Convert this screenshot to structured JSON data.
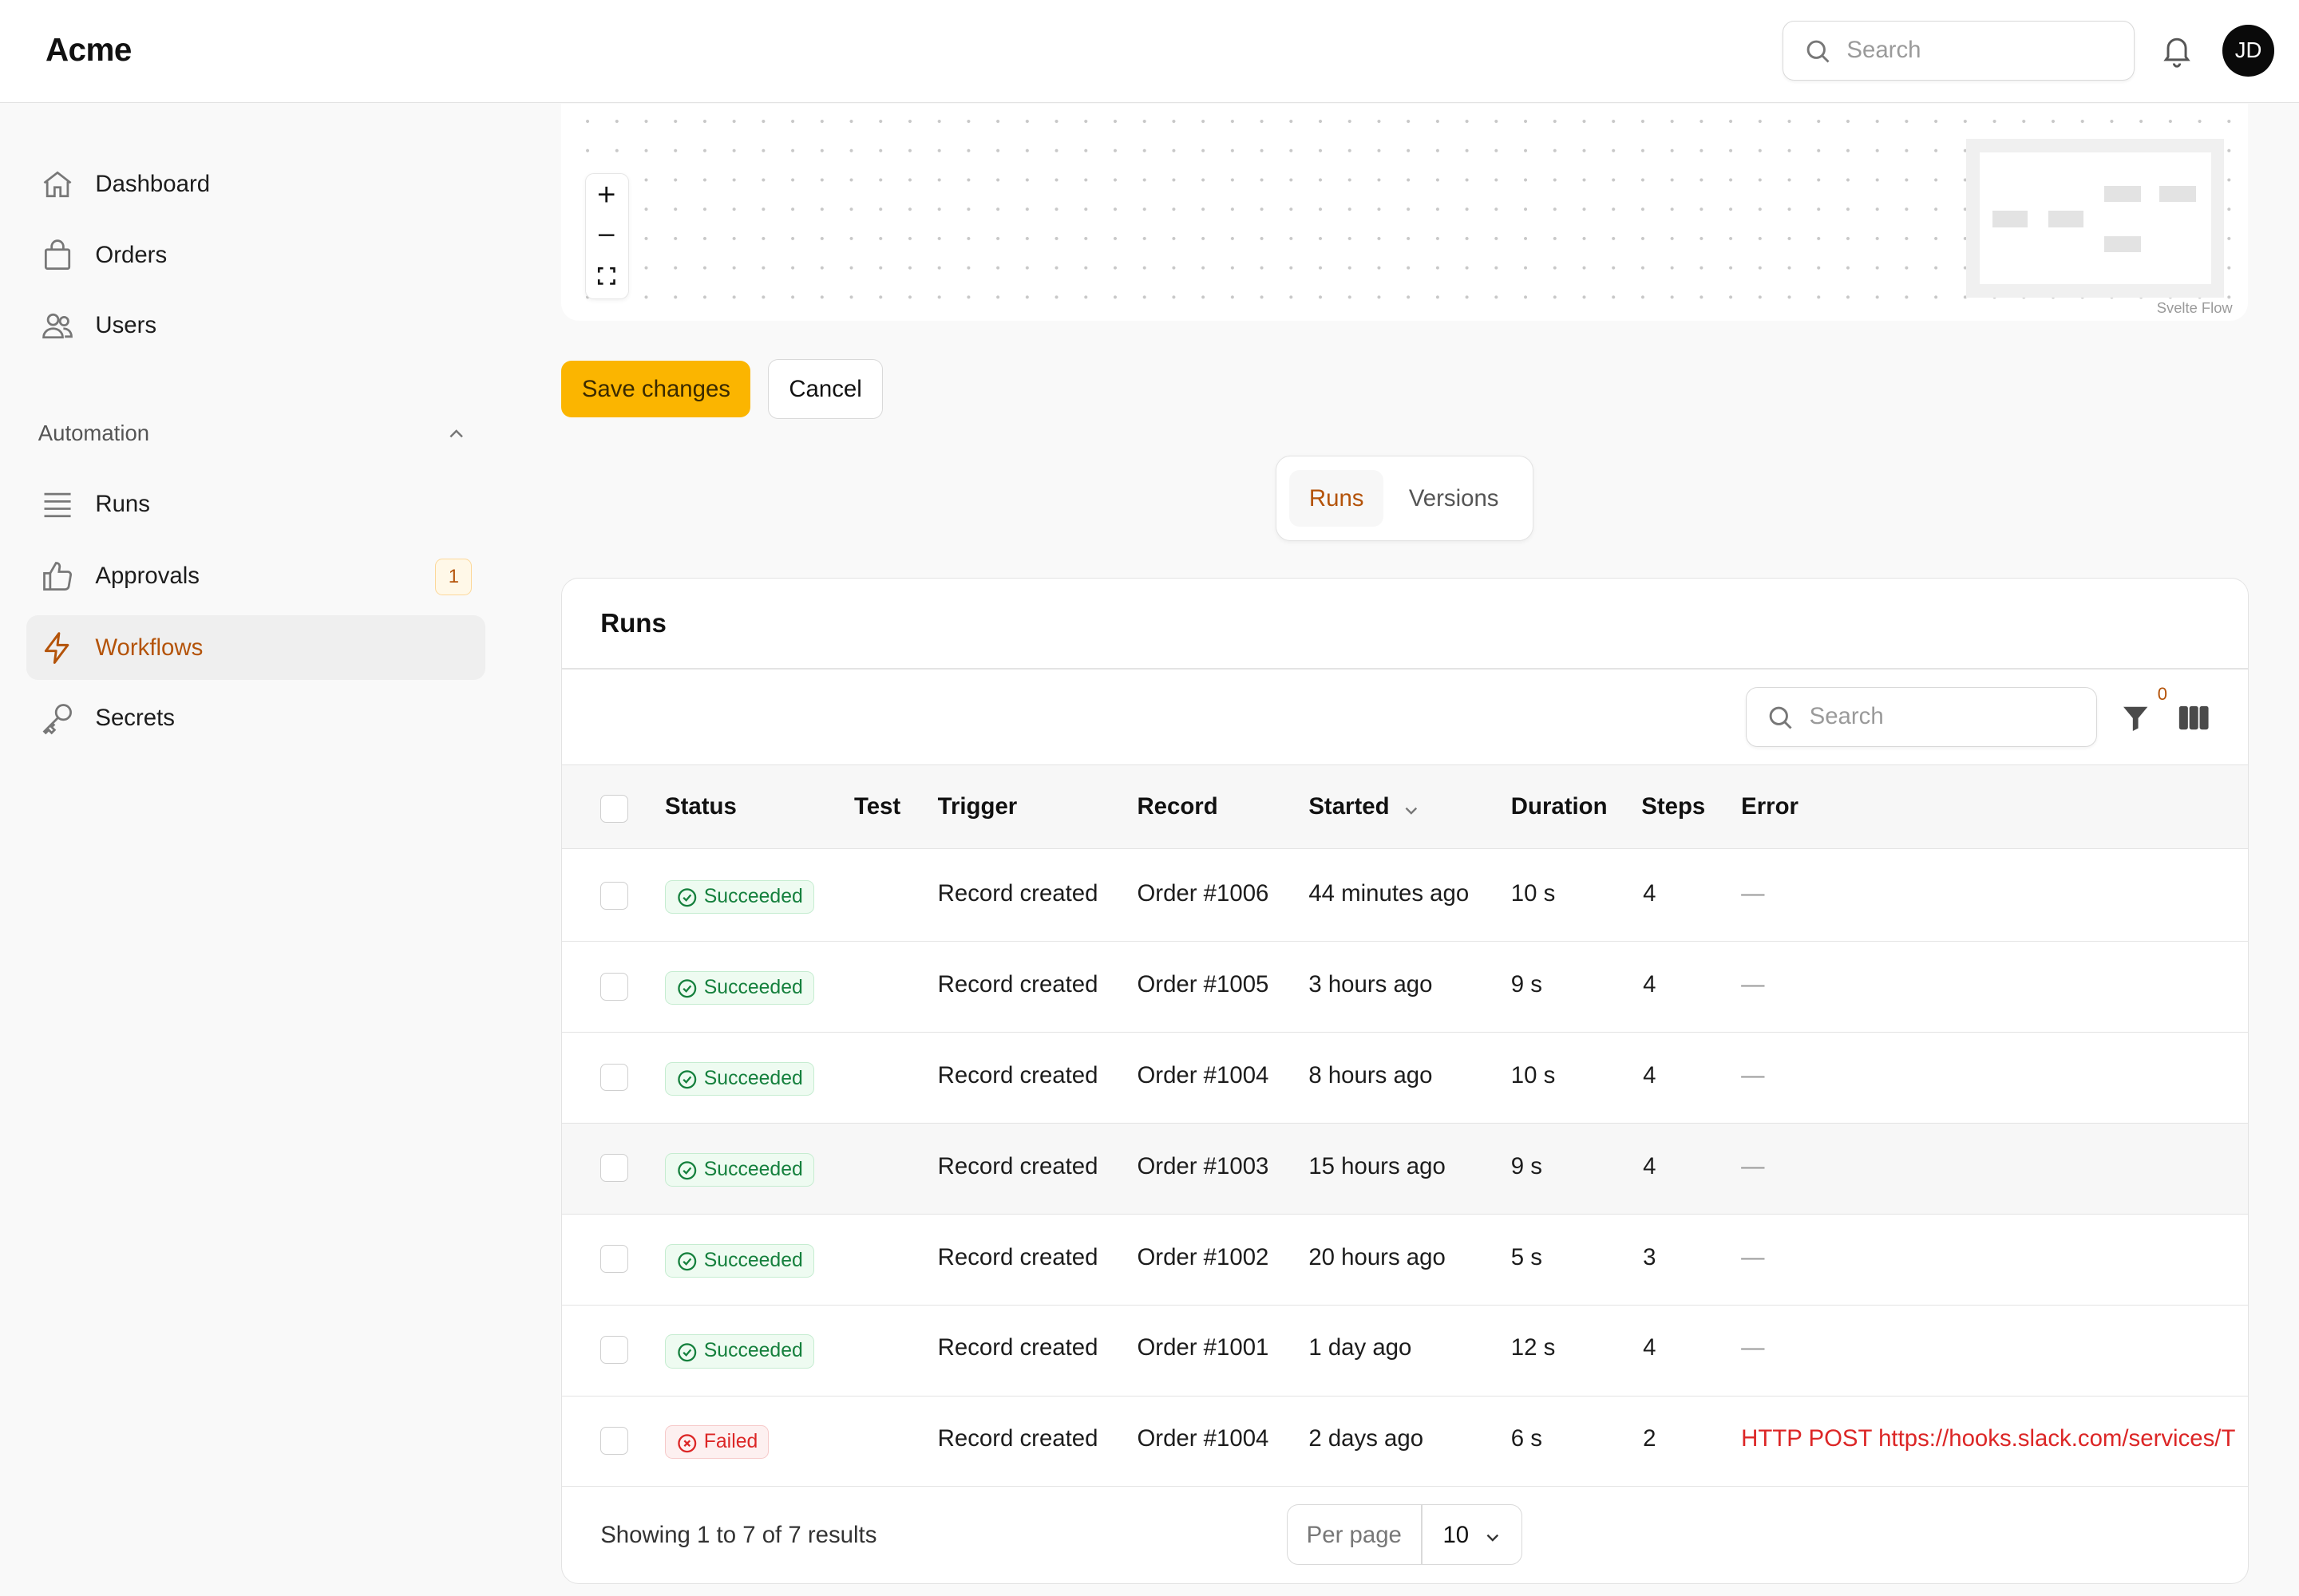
{
  "header": {
    "brand": "Acme",
    "search_placeholder": "Search",
    "avatar_initials": "JD"
  },
  "sidebar": {
    "items": [
      {
        "label": "Dashboard",
        "icon": "home-icon"
      },
      {
        "label": "Orders",
        "icon": "shopping-bag-icon"
      },
      {
        "label": "Users",
        "icon": "users-icon"
      }
    ],
    "section_title": "Automation",
    "section_items": [
      {
        "label": "Runs",
        "icon": "list-icon"
      },
      {
        "label": "Approvals",
        "icon": "thumbs-up-icon",
        "badge": "1"
      },
      {
        "label": "Workflows",
        "icon": "bolt-icon",
        "active": true
      },
      {
        "label": "Secrets",
        "icon": "key-icon"
      }
    ]
  },
  "canvas": {
    "credit": "Svelte Flow"
  },
  "actions": {
    "save_label": "Save changes",
    "cancel_label": "Cancel"
  },
  "tabs": {
    "runs": "Runs",
    "versions": "Versions",
    "active": "Runs"
  },
  "runs_card": {
    "title": "Runs",
    "search_placeholder": "Search",
    "filter_count": "0",
    "columns": {
      "status": "Status",
      "test": "Test",
      "trigger": "Trigger",
      "record": "Record",
      "started": "Started",
      "duration": "Duration",
      "steps": "Steps",
      "error": "Error"
    },
    "rows": [
      {
        "status": "Succeeded",
        "trigger": "Record created",
        "record": "Order #1006",
        "started": "44 minutes ago",
        "duration": "10 s",
        "steps": "4",
        "error": "—"
      },
      {
        "status": "Succeeded",
        "trigger": "Record created",
        "record": "Order #1005",
        "started": "3 hours ago",
        "duration": "9 s",
        "steps": "4",
        "error": "—"
      },
      {
        "status": "Succeeded",
        "trigger": "Record created",
        "record": "Order #1004",
        "started": "8 hours ago",
        "duration": "10 s",
        "steps": "4",
        "error": "—"
      },
      {
        "status": "Succeeded",
        "trigger": "Record created",
        "record": "Order #1003",
        "started": "15 hours ago",
        "duration": "9 s",
        "steps": "4",
        "error": "—"
      },
      {
        "status": "Succeeded",
        "trigger": "Record created",
        "record": "Order #1002",
        "started": "20 hours ago",
        "duration": "5 s",
        "steps": "3",
        "error": "—"
      },
      {
        "status": "Succeeded",
        "trigger": "Record created",
        "record": "Order #1001",
        "started": "1 day ago",
        "duration": "12 s",
        "steps": "4",
        "error": "—"
      },
      {
        "status": "Failed",
        "trigger": "Record created",
        "record": "Order #1004",
        "started": "2 days ago",
        "duration": "6 s",
        "steps": "2",
        "error": "HTTP POST https://hooks.slack.com/services/T"
      }
    ],
    "footer": "Showing 1 to 7 of 7 results",
    "per_page_label": "Per page",
    "per_page_value": "10"
  },
  "colors": {
    "accent": "#b45309",
    "primary_button": "#fbb500",
    "success": "#15803d",
    "danger": "#dc2626"
  }
}
